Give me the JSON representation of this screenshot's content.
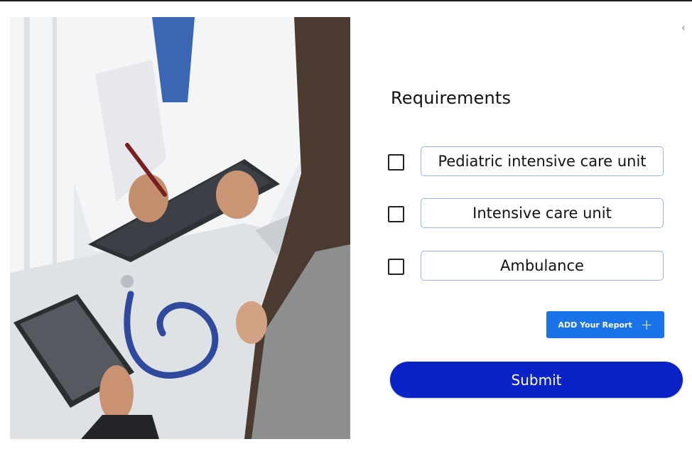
{
  "page": {
    "title": "Requirements",
    "back_icon": "chevron-left-icon"
  },
  "photo": {
    "subject": "doctor-consultation-photo"
  },
  "requirements": [
    {
      "label": "Pediatric intensive care unit",
      "checked": false
    },
    {
      "label": "Intensive care unit",
      "checked": false
    },
    {
      "label": "Ambulance",
      "checked": false
    }
  ],
  "buttons": {
    "add_report_label": "ADD Your Report",
    "add_report_icon": "plus-icon",
    "submit_label": "Submit"
  },
  "colors": {
    "add_report_bg": "#1a73e8",
    "submit_bg": "#0b22c4",
    "field_border": "#9ab6e3"
  }
}
